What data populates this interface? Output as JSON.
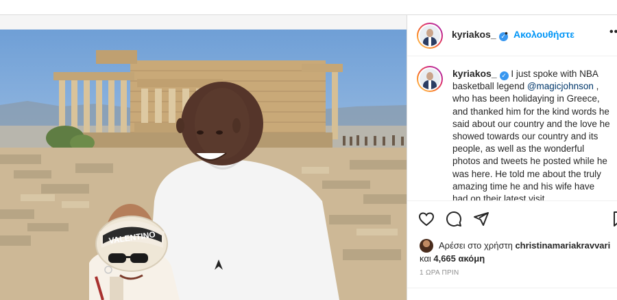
{
  "post": {
    "username": "kyriakos_",
    "follow_label": "Ακολουθήστε",
    "more_icon": "•••",
    "caption_user": "kyriakos_",
    "caption_part1": "I just spoke with NBA basketball legend ",
    "caption_mention": "@magicjohnson",
    "caption_part2": " , who has been holidaying in Greece, and thanked him for the kind words he said about our country and the love he showed towards our country and its people, as well as the wonderful photos and tweets he posted while he was here. He told me about the truly amazing time he and his wife have had on their latest visit",
    "hat_text": "VALENTINO",
    "likes_prefix": "Αρέσει στο χρήστη ",
    "likes_user": "christinamariakravvari",
    "likes_and": "και ",
    "likes_count": "4,665 ακόμη",
    "timestamp": "1 ΩΡΑ ΠΡΙΝ"
  },
  "colors": {
    "accent": "#0095f6",
    "verified": "#3897f0",
    "text": "#262626",
    "muted": "#8e8e8e"
  },
  "icons": [
    "heart-icon",
    "comment-icon",
    "share-icon",
    "bookmark-icon",
    "verified-icon",
    "more-icon"
  ]
}
